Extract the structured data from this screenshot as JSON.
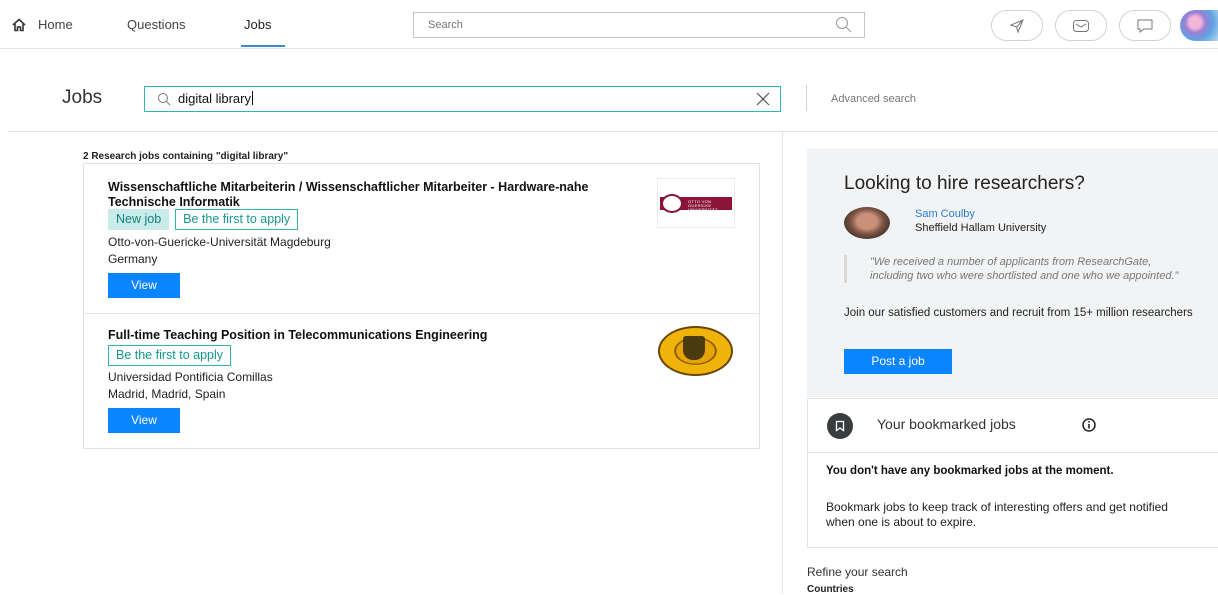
{
  "nav": {
    "home_label": "Home",
    "questions_label": "Questions",
    "jobs_label": "Jobs",
    "search_placeholder": "Search"
  },
  "jobs_search": {
    "heading": "Jobs",
    "query": "digital library",
    "advanced_search_label": "Advanced search"
  },
  "results": {
    "count_text": "2 Research jobs containing \"digital library\"",
    "jobs": [
      {
        "title": "Wissenschaftliche Mitarbeiterin / Wissenschaftlicher Mitarbeiter - Hardware-nahe Technische Informatik",
        "tags": [
          "New job",
          "Be the first to apply"
        ],
        "institution": "Otto-von-Guericke-Universität Magdeburg",
        "location": "Germany",
        "view_label": "View"
      },
      {
        "title": "Full-time Teaching Position in Telecommunications Engineering",
        "tags": [
          "Be the first to apply"
        ],
        "institution": "Universidad Pontificia Comillas",
        "location": "Madrid, Madrid, Spain",
        "view_label": "View"
      }
    ]
  },
  "hire": {
    "title": "Looking to hire researchers?",
    "testimonial_name": "Sam Coulby",
    "testimonial_institution": "Sheffield Hallam University",
    "quote": "\"We received a number of applicants from ResearchGate, including two who were shortlisted and one who we appointed.\"",
    "description": "Join our satisfied customers and recruit from 15+ million researchers",
    "post_button": "Post a job"
  },
  "bookmarks": {
    "title": "Your bookmarked jobs",
    "empty_title": "You don't have any bookmarked jobs at the moment.",
    "empty_description": "Bookmark jobs to keep track of interesting offers and get notified when one is about to expire."
  },
  "refine": {
    "title": "Refine your search",
    "countries_label": "Countries"
  },
  "colors": {
    "accent_teal": "#2fb7ac",
    "primary_blue": "#0a84ff",
    "link_blue": "#2a7dd6"
  }
}
